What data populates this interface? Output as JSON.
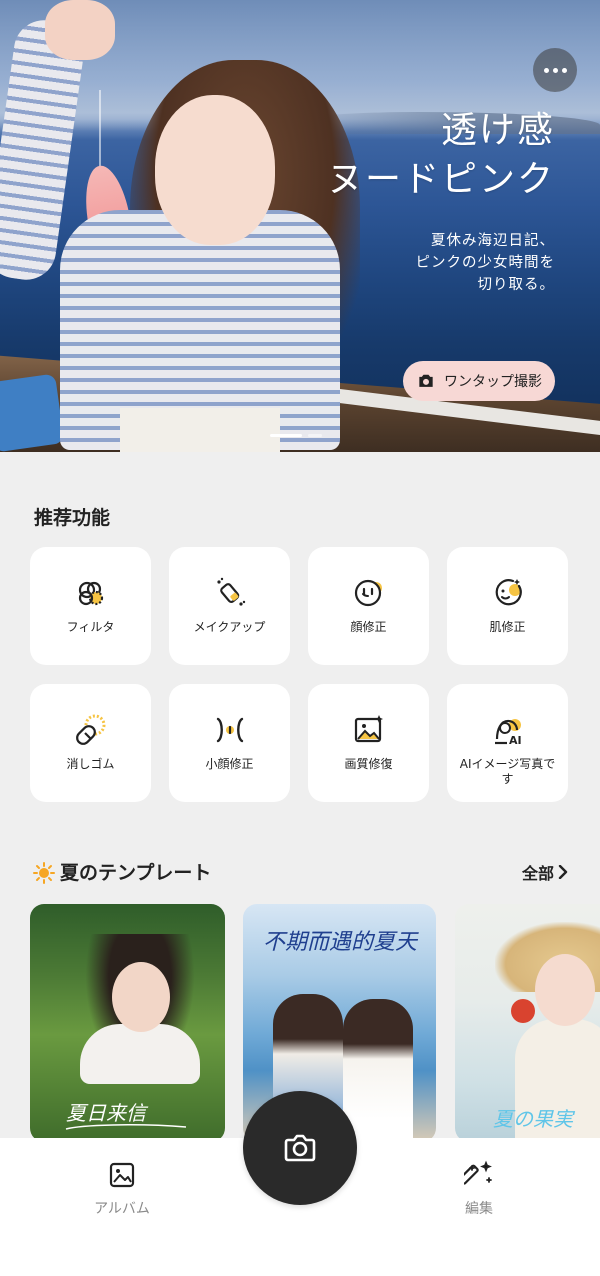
{
  "hero": {
    "title_line1": "透け感",
    "title_line2": "ヌードピンク",
    "subtitle_line1": "夏休み海辺日記、",
    "subtitle_line2": "ピンクの少女時間を",
    "subtitle_line3": "切り取る。",
    "cta_label": "ワンタップ撮影",
    "more_icon": "more-horizontal-icon"
  },
  "features": {
    "title": "推荐功能",
    "items": [
      {
        "label": "フィルタ",
        "icon": "filter-icon"
      },
      {
        "label": "メイクアップ",
        "icon": "makeup-icon"
      },
      {
        "label": "顔修正",
        "icon": "face-retouch-icon"
      },
      {
        "label": "肌修正",
        "icon": "skin-retouch-icon"
      },
      {
        "label": "消しゴム",
        "icon": "eraser-icon"
      },
      {
        "label": "小顔修正",
        "icon": "slim-face-icon"
      },
      {
        "label": "画質修復",
        "icon": "image-restore-icon"
      },
      {
        "label": "AIイメージ写真です",
        "icon": "ai-portrait-icon"
      }
    ]
  },
  "templates": {
    "title": "夏のテンプレート",
    "all_label": "全部",
    "title_icon": "sun-icon",
    "cards": [
      {
        "caption": "夏日来信"
      },
      {
        "caption": "不期而遇的夏天"
      },
      {
        "caption": "夏の果実"
      }
    ]
  },
  "bottom_nav": {
    "album_label": "アルバム",
    "edit_label": "編集",
    "camera_icon": "camera-icon"
  },
  "colors": {
    "accent_yellow": "#f6c443",
    "cta_background": "#f7d8d5",
    "camera_button": "#2a2a2a",
    "page_background": "#efefef"
  }
}
